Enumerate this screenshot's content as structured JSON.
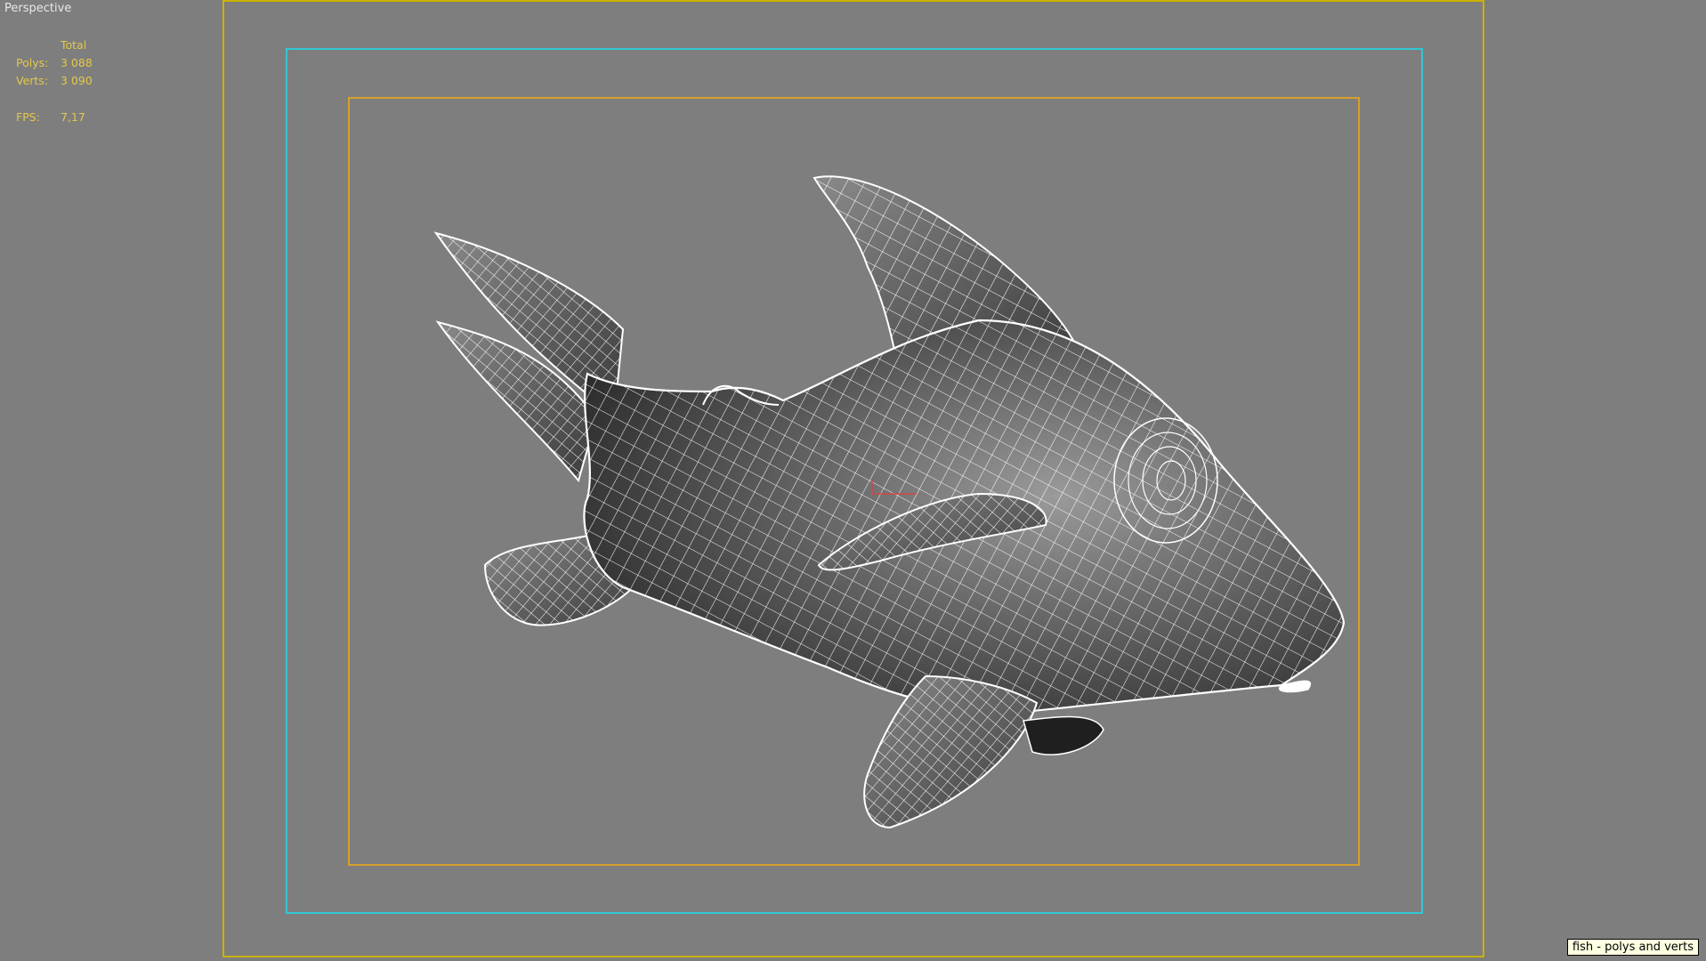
{
  "viewport": {
    "label": "Perspective",
    "background_color": "#7e7e7e",
    "wire_color": "#ffffff"
  },
  "stats": {
    "header": "Total",
    "polys_label": "Polys:",
    "polys_value": "3 088",
    "verts_label": "Verts:",
    "verts_value": "3 090",
    "fps_label": "FPS:",
    "fps_value": "7,17",
    "color": "#e4c84a"
  },
  "frames": {
    "safe_frame_color": "#c9b200",
    "action_safe_color": "#33c6d2",
    "title_safe_color": "#d7a02c"
  },
  "tooltip": {
    "text": "fish - polys and verts"
  },
  "model": {
    "icon": "fish-wireframe-mesh"
  }
}
